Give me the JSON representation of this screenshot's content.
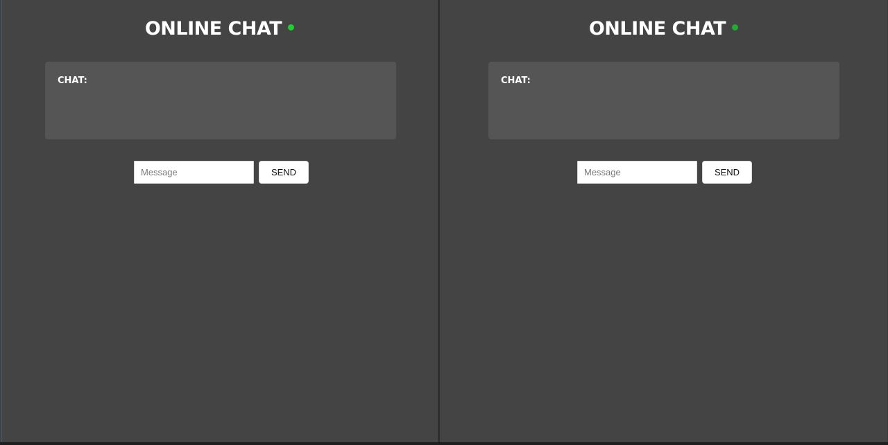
{
  "panes": [
    {
      "title": "ONLINE CHAT",
      "status_color": "#22cc33",
      "chat_label": "CHAT:",
      "messages": [],
      "input": {
        "value": "",
        "placeholder": "Message"
      },
      "send_label": "SEND"
    },
    {
      "title": "ONLINE CHAT",
      "status_color": "#22aa33",
      "chat_label": "CHAT:",
      "messages": [],
      "input": {
        "value": "",
        "placeholder": "Message"
      },
      "send_label": "SEND"
    }
  ],
  "colors": {
    "background": "#444444",
    "chat_box": "#555555",
    "text": "#ffffff"
  }
}
